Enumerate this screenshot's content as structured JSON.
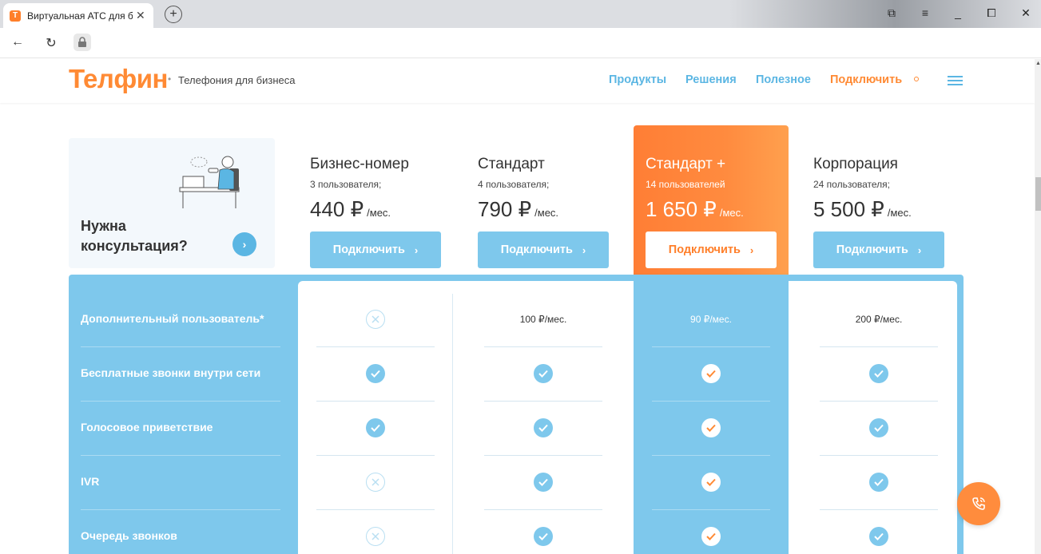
{
  "browser": {
    "tab_title": "Виртуальная АТС для б",
    "tab_favicon_letter": "T",
    "tab_close": "✕",
    "new_tab": "+",
    "window_controls": [
      "⧉",
      "≡",
      "_",
      "⧠",
      "✕"
    ],
    "back": "←",
    "reload": "↻"
  },
  "header": {
    "logo": "Телфин",
    "tagline": "Телефония для бизнеса",
    "menu": [
      "Продукты",
      "Решения",
      "Полезное",
      "Подключить"
    ]
  },
  "consult": {
    "title": "Нужна консультация?",
    "arrow": "›"
  },
  "plans": [
    {
      "name": "Бизнес-номер",
      "users": "3 пользователя;",
      "price": "440 ₽",
      "unit": "/мес.",
      "button": "Подключить",
      "arrow": "›"
    },
    {
      "name": "Стандарт",
      "users": "4 пользователя;",
      "price": "790 ₽",
      "unit": "/мес.",
      "button": "Подключить",
      "arrow": "›"
    },
    {
      "name": "Стандарт +",
      "users": "14 пользователей",
      "price": "1 650 ₽",
      "unit": "/мес.",
      "button": "Подключить",
      "arrow": "›"
    },
    {
      "name": "Корпорация",
      "users": "24 пользователя;",
      "price": "5 500 ₽",
      "unit": "/мес.",
      "button": "Подключить",
      "arrow": "›"
    }
  ],
  "features": [
    {
      "label": "Дополнительный пользователь*",
      "cells": [
        "x",
        "100 ₽/мес.",
        "90 ₽/мес.",
        "200 ₽/мес."
      ]
    },
    {
      "label": "Бесплатные звонки внутри сети",
      "cells": [
        "check",
        "check",
        "check",
        "check"
      ]
    },
    {
      "label": "Голосовое приветствие",
      "cells": [
        "check",
        "check",
        "check",
        "check"
      ]
    },
    {
      "label": "IVR",
      "cells": [
        "x",
        "check",
        "check",
        "check"
      ]
    },
    {
      "label": "Очередь звонков",
      "cells": [
        "x",
        "check",
        "check",
        "check"
      ]
    }
  ],
  "colors": {
    "brand_orange": "#ff8a34",
    "brand_blue": "#7ec8ec",
    "link_blue": "#5bb6e3"
  },
  "icons": {
    "check": "check-icon",
    "x": "unavailable-x-icon",
    "fab": "phone-callback-icon"
  }
}
